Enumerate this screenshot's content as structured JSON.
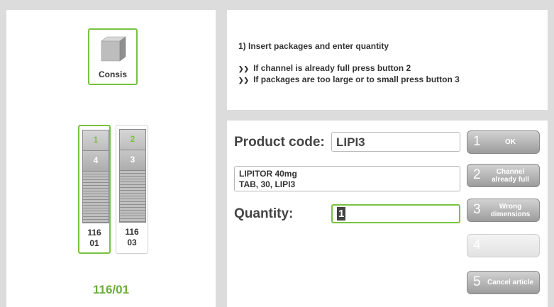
{
  "left": {
    "machine_label": "Consis",
    "channels": [
      {
        "top": "1",
        "mid": "4",
        "id_line1": "116",
        "id_line2": "01"
      },
      {
        "top": "2",
        "mid": "3",
        "id_line1": "116",
        "id_line2": "03"
      }
    ],
    "selected_channel": "116/01"
  },
  "instructions": {
    "title": "1) Insert packages and enter quantity",
    "bullets": [
      "If channel is already full press button 2",
      "If packages are too large or to small press button 3"
    ]
  },
  "form": {
    "product_code_label": "Product code:",
    "product_code_value": "LIPI3",
    "description_line1": "LIPITOR 40mg",
    "description_line2": "TAB, 30, LIPI3",
    "quantity_label": "Quantity:",
    "quantity_value": "1"
  },
  "buttons": [
    {
      "num": "1",
      "label": "OK"
    },
    {
      "num": "2",
      "label": "Channel already full"
    },
    {
      "num": "3",
      "label": "Wrong dimensions"
    },
    {
      "num": "4",
      "label": ""
    },
    {
      "num": "5",
      "label": "Cancel article"
    }
  ],
  "colors": {
    "accent": "#7ac142",
    "button": "#a8a8a8",
    "background": "#dcdcdc"
  }
}
